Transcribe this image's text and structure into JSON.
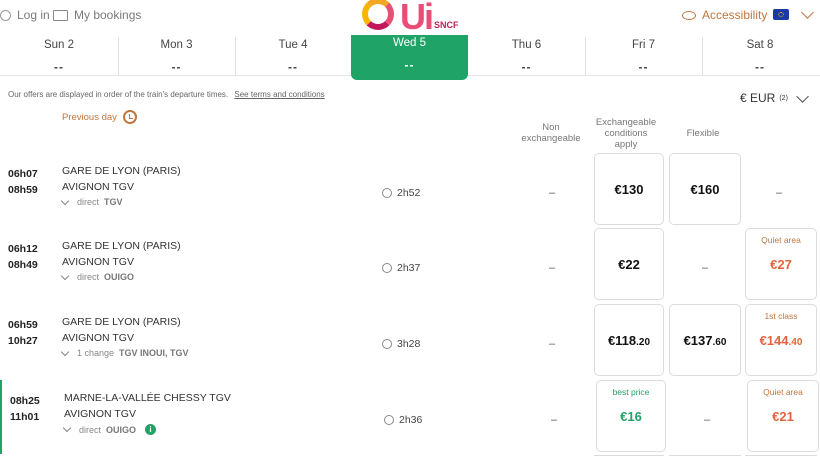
{
  "header": {
    "login": "Log in",
    "bookings": "My bookings",
    "accessibility": "Accessibility",
    "logo_text": "Ui",
    "logo_sub": "SNCF"
  },
  "days": [
    {
      "name": "Sun 2",
      "price": "--"
    },
    {
      "name": "Mon 3",
      "price": "--"
    },
    {
      "name": "Tue 4",
      "price": "--"
    },
    {
      "name": "Wed 5",
      "price": "--"
    },
    {
      "name": "Thu 6",
      "price": "--"
    },
    {
      "name": "Fri 7",
      "price": "--"
    },
    {
      "name": "Sat 8",
      "price": "--"
    }
  ],
  "note": {
    "text": "Our offers are displayed in order of the train's departure times.",
    "link": "See terms and conditions"
  },
  "previous_day": "Previous day",
  "currency": {
    "label": "€ EUR",
    "sup": "(2)"
  },
  "columns": {
    "non_exch": "Non exchangeable",
    "exch": "Exchangeable conditions apply",
    "flex": "Flexible"
  },
  "rows": [
    {
      "dep": "06h07",
      "arr": "08h59",
      "from": "GARE DE LYON (PARIS)",
      "to": "AVIGNON TGV",
      "type": "direct",
      "train": "TGV",
      "duration": "2h52",
      "non_exch": "–",
      "exch": "€130",
      "flex": "€160",
      "extra": "–"
    },
    {
      "dep": "06h12",
      "arr": "08h49",
      "from": "GARE DE LYON (PARIS)",
      "to": "AVIGNON TGV",
      "type": "direct",
      "train": "OUIGO",
      "duration": "2h37",
      "non_exch": "–",
      "exch": "€22",
      "flex": "–",
      "extra_label": "Quiet area",
      "extra": "€27"
    },
    {
      "dep": "06h59",
      "arr": "10h27",
      "from": "GARE DE LYON (PARIS)",
      "to": "AVIGNON TGV",
      "type": "1 change",
      "train": "TGV INOUI, TGV",
      "duration": "3h28",
      "non_exch": "–",
      "exch": "€118",
      "exch_cents": ".20",
      "flex": "€137",
      "flex_cents": ".60",
      "extra_label": "1st class",
      "extra": "€144",
      "extra_cents": ".40"
    },
    {
      "dep": "08h25",
      "arr": "11h01",
      "from": "MARNE-LA-VALLÉE CHESSY TGV",
      "to": "AVIGNON TGV",
      "type": "direct",
      "train": "OUIGO",
      "duration": "2h36",
      "non_exch": "–",
      "exch_label": "best price",
      "exch": "€16",
      "flex": "–",
      "extra_label": "Quiet area",
      "extra": "€21"
    }
  ],
  "colors": {
    "accent_green": "#1fa367",
    "accent_orange": "#e3633e"
  }
}
